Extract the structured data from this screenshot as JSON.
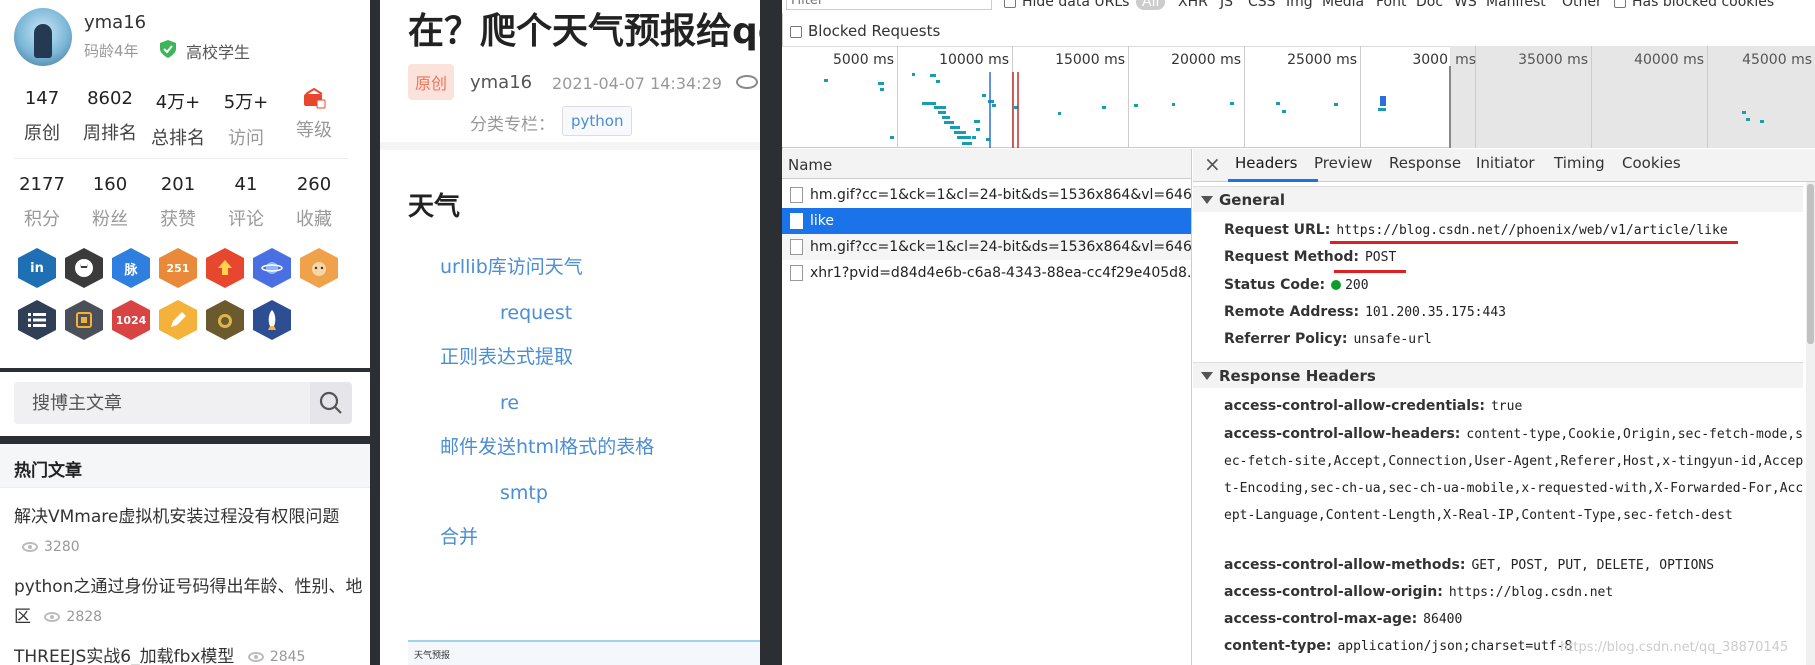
{
  "profile": {
    "username": "yma16",
    "coding_age": "码龄4年",
    "student": "高校学生",
    "stats_row1": [
      {
        "value": "147",
        "label": "原创"
      },
      {
        "value": "8602",
        "label": "周排名"
      },
      {
        "value": "4万+",
        "label": "总排名"
      },
      {
        "value": "5万+",
        "label": "访问"
      },
      {
        "value": "",
        "label": "等级"
      }
    ],
    "stats_row2": [
      {
        "value": "2177",
        "label": "积分"
      },
      {
        "value": "160",
        "label": "粉丝"
      },
      {
        "value": "201",
        "label": "获赞"
      },
      {
        "value": "41",
        "label": "评论"
      },
      {
        "value": "260",
        "label": "收藏"
      }
    ],
    "badges": [
      {
        "text": "in",
        "color": "#1f6fb4"
      },
      {
        "text": "",
        "color": "#3b3b3b"
      },
      {
        "text": "脉",
        "color": "#2f7fe0"
      },
      {
        "text": "251",
        "color": "#e98a3a"
      },
      {
        "text": "",
        "color": "#e8472f"
      },
      {
        "text": "",
        "color": "#4a6fe3"
      },
      {
        "text": "",
        "color": "#f0a24a"
      },
      {
        "text": "",
        "color": "#2f3f56"
      },
      {
        "text": "",
        "color": "#4a4f5a"
      },
      {
        "text": "1024",
        "color": "#d84343"
      },
      {
        "text": "",
        "color": "#f4b23a"
      },
      {
        "text": "",
        "color": "#6b5a2e"
      },
      {
        "text": "",
        "color": "#2e4e94"
      }
    ]
  },
  "search": {
    "placeholder": "搜博主文章"
  },
  "hot_articles": {
    "title": "热门文章",
    "items": [
      {
        "title": "解决VMmare虚拟机安装过程没有权限问题",
        "views": "3280"
      },
      {
        "title": "python之通过身份证号码得出年龄、性别、地区",
        "views": "2828"
      },
      {
        "title": "THREEJS实战6_加载fbx模型",
        "views": "2845"
      }
    ]
  },
  "article": {
    "title": "在？爬个天气预报给qq",
    "original_badge": "原创",
    "author": "yma16",
    "date": "2021-04-07 14:34:29",
    "category_label": "分类专栏：",
    "category": "python",
    "toc_heading": "天气",
    "toc": [
      "urllib库访问天气",
      "request",
      "正则表达式提取",
      "re",
      "邮件发送html格式的表格",
      "smtp",
      "合并"
    ],
    "thumb_text": "天气预报"
  },
  "devtools": {
    "filter_placeholder": "Filter",
    "hide_data_urls": "Hide data URLs",
    "all": "All",
    "types": [
      "XHR",
      "JS",
      "CSS",
      "Img",
      "Media",
      "Font",
      "Doc",
      "WS",
      "Manifest",
      "Other"
    ],
    "has_blocked_cookies": "Has blocked cookies",
    "blocked_requests": "Blocked Requests",
    "timeline_labels": [
      "5000 ms",
      "10000 ms",
      "15000 ms",
      "20000 ms",
      "25000 ms",
      "3000",
      "ms",
      "35000 ms",
      "40000 ms",
      "45000 ms"
    ],
    "name_col": "Name",
    "requests": [
      {
        "name": "hm.gif?cc=1&ck=1&cl=24-bit&ds=1536x864&vl=646...",
        "selected": false
      },
      {
        "name": "like",
        "selected": true
      },
      {
        "name": "hm.gif?cc=1&ck=1&cl=24-bit&ds=1536x864&vl=646...",
        "selected": false
      },
      {
        "name": "xhr1?pvid=d84d4e6b-c6a8-4343-88ea-cc4f29e405d8...",
        "selected": false
      }
    ],
    "tabs": [
      "Headers",
      "Preview",
      "Response",
      "Initiator",
      "Timing",
      "Cookies"
    ],
    "general_title": "General",
    "general": [
      {
        "key": "Request URL:",
        "value": "https://blog.csdn.net//phoenix/web/v1/article/like"
      },
      {
        "key": "Request Method:",
        "value": "POST"
      },
      {
        "key": "Status Code:",
        "value": "200"
      },
      {
        "key": "Remote Address:",
        "value": "101.200.35.175:443"
      },
      {
        "key": "Referrer Policy:",
        "value": "unsafe-url"
      }
    ],
    "response_title": "Response Headers",
    "response": [
      {
        "key": "access-control-allow-credentials:",
        "value": "true"
      },
      {
        "key": "access-control-allow-headers:",
        "value": "content-type,Cookie,Origin,sec-fetch-mode,sec-fetch-site,Accept,Connection,User-Agent,Referer,Host,x-tingyun-id,Accept-Encoding,sec-ch-ua,sec-ch-ua-mobile,x-requested-with,X-Forwarded-For,Accept-Language,Content-Length,X-Real-IP,Content-Type,sec-fetch-dest"
      },
      {
        "key": "access-control-allow-methods:",
        "value": "GET, POST, PUT, DELETE, OPTIONS"
      },
      {
        "key": "access-control-allow-origin:",
        "value": "https://blog.csdn.net"
      },
      {
        "key": "access-control-max-age:",
        "value": "86400"
      },
      {
        "key": "content-type:",
        "value": "application/json;charset=utf-8"
      }
    ],
    "watermark": "https://blog.csdn.net/qq_38870145"
  }
}
